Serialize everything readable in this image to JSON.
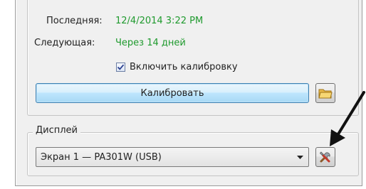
{
  "calibration": {
    "last_label": "Последняя:",
    "last_value": "12/4/2014 3:22 PM",
    "next_label": "Следующая:",
    "next_value": "Через 14 дней",
    "enable_checkbox_label": "Включить калибровку",
    "enable_checked": true,
    "calibrate_button": "Калибровать",
    "open_folder_icon": "folder-icon"
  },
  "display": {
    "group_label": "Дисплей",
    "selected_display": "Экран 1 — PA301W (USB)",
    "settings_icon": "tools-icon"
  },
  "colors": {
    "value_green": "#1f9a2e",
    "annotation_arrow": "#111111"
  }
}
